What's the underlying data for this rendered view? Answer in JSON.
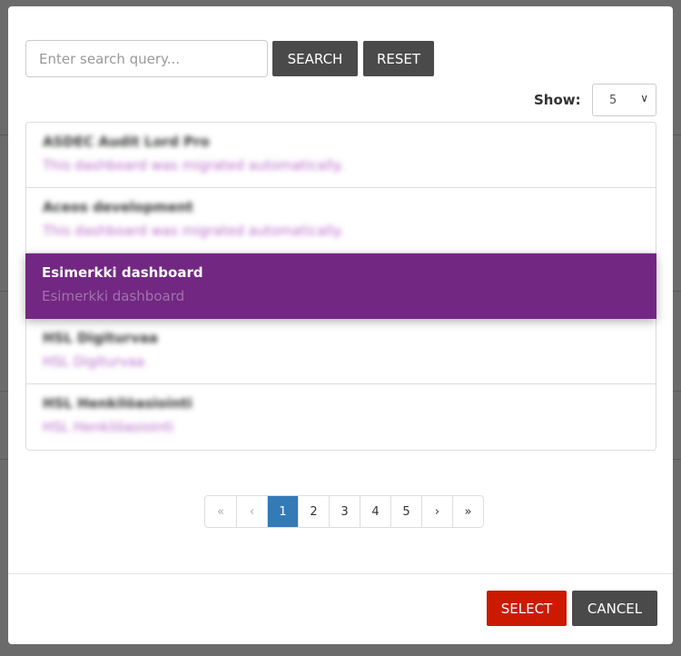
{
  "search": {
    "placeholder": "Enter search query...",
    "search_label": "SEARCH",
    "reset_label": "RESET"
  },
  "show": {
    "label": "Show:",
    "value": "5"
  },
  "items": [
    {
      "title": "ASDEC Audit Lord Pro",
      "description": "This dashboard was migrated automatically."
    },
    {
      "title": "Aceos development",
      "description": "This dashboard was migrated automatically."
    },
    {
      "title": "Esimerkki dashboard",
      "description": "Esimerkki dashboard",
      "selected": true
    },
    {
      "title": "HSL Digiturvaa",
      "description": "HSL Digiturvaa"
    },
    {
      "title": "HSL Henkilöasiointi",
      "description": "HSL Henkilöasiointi"
    }
  ],
  "pagination": {
    "first": "«",
    "prev": "‹",
    "pages": [
      "1",
      "2",
      "3",
      "4",
      "5"
    ],
    "current": "1",
    "next": "›",
    "last": "»"
  },
  "footer": {
    "select_label": "SELECT",
    "cancel_label": "CANCEL"
  },
  "colors": {
    "selected": "#722783",
    "select_button": "#cc1a00",
    "dark_button": "#4a4a4a",
    "active_page": "#337ab7"
  }
}
